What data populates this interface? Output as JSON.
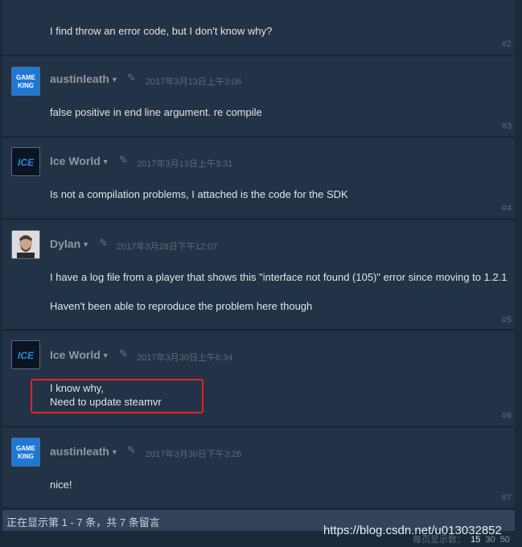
{
  "posts": [
    {
      "author": "",
      "date": "",
      "text": "I find throw an error code, but I don't know why?",
      "text2": "",
      "num": "#2"
    },
    {
      "author": "austinleath",
      "date": "2017年3月13日上午3:06",
      "text": "false positive in end line argument. re compile",
      "text2": "",
      "num": "#3",
      "avatar": "game-king"
    },
    {
      "author": "Ice World",
      "date": "2017年3月13日上午3:31",
      "text": "Is not a compilation problems, I attached is the code for the SDK",
      "text2": "",
      "num": "#4",
      "avatar": "ice"
    },
    {
      "author": "Dylan",
      "date": "2017年3月28日下午12:07",
      "text": "I have a log file from a player that shows this \"interface not found (105)\" error since moving to 1.2.1",
      "text2": "Haven't been able to reproduce the problem here though",
      "num": "#5",
      "avatar": "photo"
    },
    {
      "author": "Ice World",
      "date": "2017年3月30日上午6:34",
      "text": "I know why,",
      "text2": "Need to update steamvr",
      "num": "#6",
      "avatar": "ice"
    },
    {
      "author": "austinleath",
      "date": "2017年3月30日下午3:26",
      "text": "nice!",
      "text2": "",
      "num": "#7",
      "avatar": "game-king"
    }
  ],
  "avatar_text": {
    "game_line1": "GAME",
    "game_line2": "KING",
    "ice": "ICE"
  },
  "footer": {
    "showing": "正在显示第 1 - 7 条，共 7 条留言"
  },
  "per_page": {
    "label": "每页显示数：",
    "opt1": "15",
    "opt2": "30",
    "opt3": "50",
    "selected": "15"
  },
  "watermark": "https://blog.csdn.net/u013032852",
  "colors": {
    "background": "#1b2838",
    "post": "#223247",
    "highlight": "#e3251f"
  }
}
